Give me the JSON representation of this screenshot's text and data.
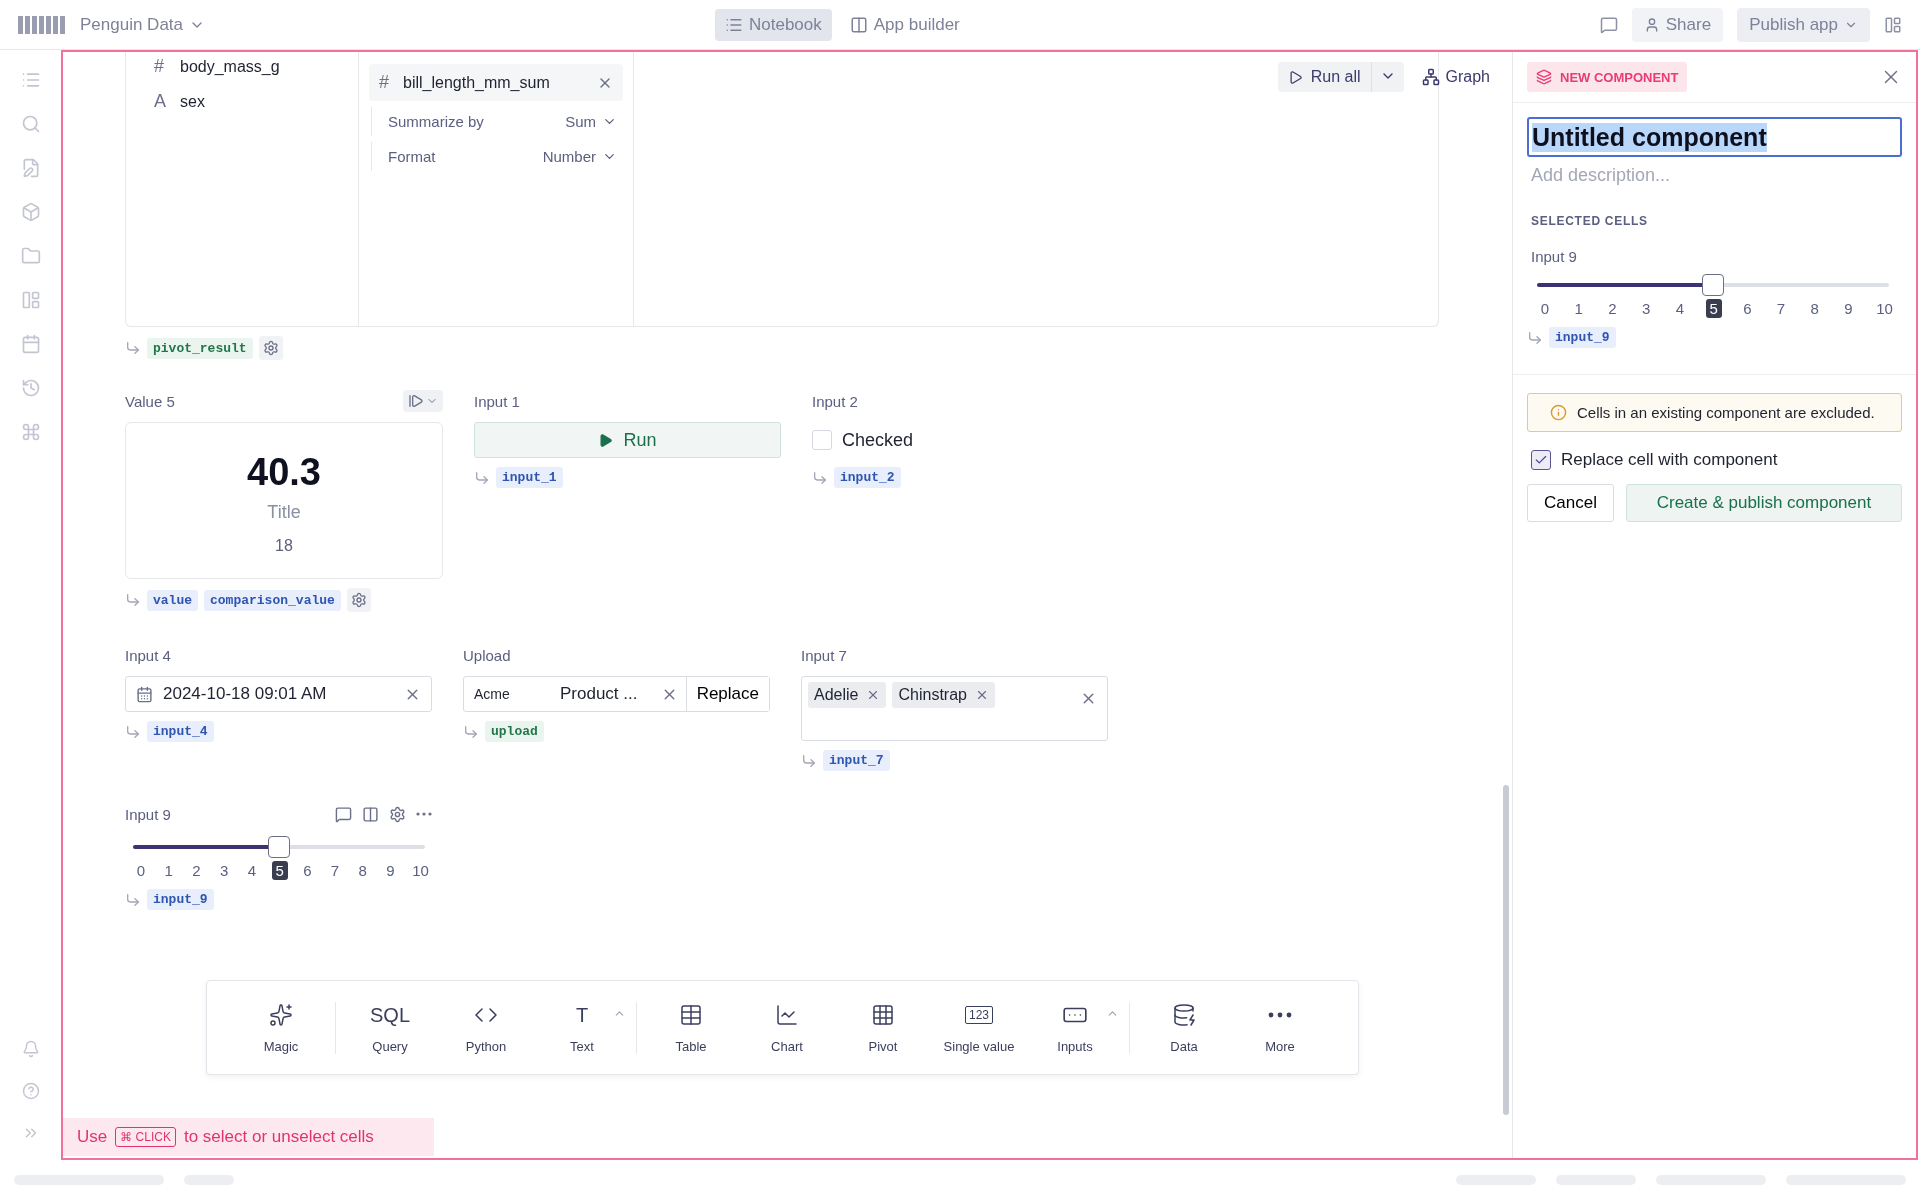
{
  "top_bar": {
    "app_name": "Penguin Data",
    "tabs": [
      {
        "label": "Notebook",
        "selected": true
      },
      {
        "label": "App builder",
        "selected": false
      }
    ],
    "share": "Share",
    "publish": "Publish app"
  },
  "pivot": {
    "fields": [
      {
        "glyph": "#",
        "name": "body_mass_g"
      },
      {
        "glyph": "A",
        "name": "sex"
      }
    ],
    "value_chip": {
      "glyph": "#",
      "name": "bill_length_mm_sum"
    },
    "options": [
      {
        "label": "Summarize by",
        "value": "Sum"
      },
      {
        "label": "Format",
        "value": "Number"
      }
    ],
    "outputs": [
      {
        "name": "pivot_result",
        "kind": "dataframe"
      }
    ]
  },
  "run_all": "Run all",
  "graph": "Graph",
  "value_cell": {
    "label": "Value 5",
    "value": "40.3",
    "title": "Title",
    "comparison": "18",
    "outputs": [
      {
        "name": "value",
        "kind": "variable"
      },
      {
        "name": "comparison_value",
        "kind": "variable"
      }
    ]
  },
  "run_cell": {
    "label": "Input 1",
    "button": "Run",
    "outputs": [
      {
        "name": "input_1",
        "kind": "variable"
      }
    ]
  },
  "checkbox_cell": {
    "label": "Input 2",
    "text": "Checked",
    "checked": false,
    "outputs": [
      {
        "name": "input_2",
        "kind": "variable"
      }
    ]
  },
  "date_cell": {
    "label": "Input 4",
    "value": "2024-10-18 09:01 AM",
    "outputs": [
      {
        "name": "input_4",
        "kind": "variable"
      }
    ]
  },
  "upload_cell": {
    "label": "Upload",
    "source": "Acme",
    "file": "Product ...",
    "button": "Replace",
    "outputs": [
      {
        "name": "upload",
        "kind": "dataframe"
      }
    ]
  },
  "multiselect_cell": {
    "label": "Input 7",
    "chips": [
      "Adelie",
      "Chinstrap"
    ],
    "outputs": [
      {
        "name": "input_7",
        "kind": "variable"
      }
    ]
  },
  "slider_cell": {
    "label": "Input 9",
    "level": 0.5,
    "ticks": [
      {
        "label": "0",
        "selected": false
      },
      {
        "label": "1",
        "selected": false
      },
      {
        "label": "2",
        "selected": false
      },
      {
        "label": "3",
        "selected": false
      },
      {
        "label": "4",
        "selected": false
      },
      {
        "label": "5",
        "selected": true
      },
      {
        "label": "6",
        "selected": false
      },
      {
        "label": "7",
        "selected": false
      },
      {
        "label": "8",
        "selected": false
      },
      {
        "label": "9",
        "selected": false
      },
      {
        "label": "10",
        "selected": false
      }
    ],
    "outputs": [
      {
        "name": "input_9",
        "kind": "variable"
      }
    ]
  },
  "toolbar": [
    [
      {
        "label": "Magic",
        "kind": "magic"
      }
    ],
    [
      {
        "label": "Query",
        "kind": "glyph",
        "glyph": "SQL"
      },
      {
        "label": "Python",
        "kind": "python"
      },
      {
        "label": "Text",
        "kind": "glyph",
        "glyph": "T",
        "caret": true
      }
    ],
    [
      {
        "label": "Table",
        "kind": "table"
      },
      {
        "label": "Chart",
        "kind": "chart"
      },
      {
        "label": "Pivot",
        "kind": "pivot"
      },
      {
        "label": "Single value",
        "kind": "boxed",
        "glyph": "123"
      },
      {
        "label": "Inputs",
        "kind": "inputs",
        "caret": true
      }
    ],
    [
      {
        "label": "Data",
        "kind": "data"
      },
      {
        "label": "More",
        "kind": "more"
      }
    ]
  ],
  "hint": {
    "before": "Use",
    "key_symbol": "⌘",
    "key": "CLICK",
    "after": "to select or unselect cells"
  },
  "panel": {
    "badge": "NEW COMPONENT",
    "title": "Untitled component",
    "description_placeholder": "Add description...",
    "section": "SELECTED CELLS",
    "cell_label": "Input 9",
    "level": 0.5,
    "ticks": [
      {
        "label": "0",
        "selected": false
      },
      {
        "label": "1",
        "selected": false
      },
      {
        "label": "2",
        "selected": false
      },
      {
        "label": "3",
        "selected": false
      },
      {
        "label": "4",
        "selected": false
      },
      {
        "label": "5",
        "selected": true
      },
      {
        "label": "6",
        "selected": false
      },
      {
        "label": "7",
        "selected": false
      },
      {
        "label": "8",
        "selected": false
      },
      {
        "label": "9",
        "selected": false
      },
      {
        "label": "10",
        "selected": false
      }
    ],
    "output": {
      "name": "input_9",
      "kind": "variable"
    },
    "alert": "Cells in an existing component are excluded.",
    "replace": {
      "label": "Replace cell with component",
      "checked": true
    },
    "cancel": "Cancel",
    "create": "Create & publish component"
  }
}
